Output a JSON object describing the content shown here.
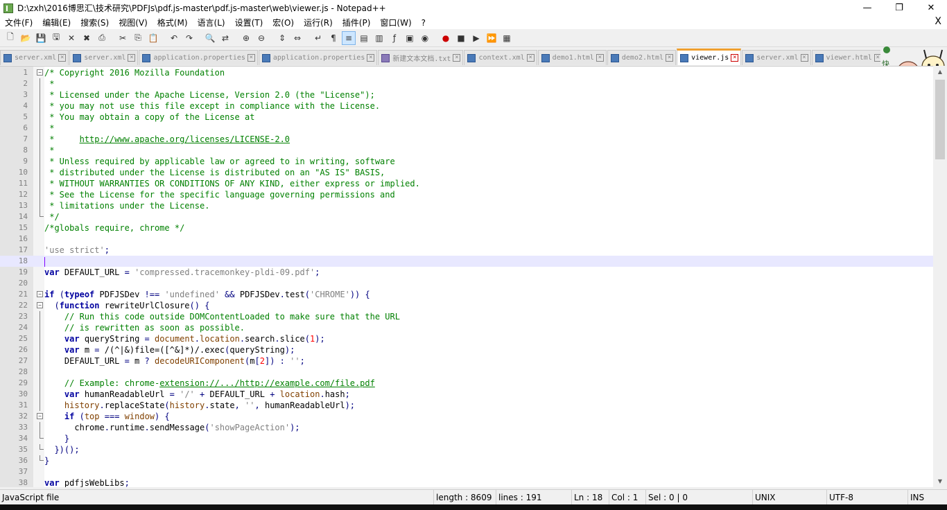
{
  "window": {
    "title": "D:\\zxh\\2016博思汇\\技术研究\\PDFJs\\pdf.js-master\\pdf.js-master\\web\\viewer.js - Notepad++",
    "minimize": "—",
    "maximize": "❐",
    "close": "✕"
  },
  "menu": {
    "items": [
      "文件(F)",
      "编辑(E)",
      "搜索(S)",
      "视图(V)",
      "格式(M)",
      "语言(L)",
      "设置(T)",
      "宏(O)",
      "运行(R)",
      "插件(P)",
      "窗口(W)",
      "?"
    ],
    "close": "X"
  },
  "tabs": [
    {
      "label": "server.xml",
      "active": false,
      "icon": "file-icon"
    },
    {
      "label": "server.xml",
      "active": false,
      "icon": "file-icon"
    },
    {
      "label": "application.properties",
      "active": false,
      "icon": "file-icon"
    },
    {
      "label": "application.properties",
      "active": false,
      "icon": "file-icon"
    },
    {
      "label": "新建文本文档.txt",
      "active": false,
      "icon": "text-file-icon"
    },
    {
      "label": "context.xml",
      "active": false,
      "icon": "file-icon"
    },
    {
      "label": "demo1.html",
      "active": false,
      "icon": "file-icon"
    },
    {
      "label": "demo2.html",
      "active": false,
      "icon": "file-icon"
    },
    {
      "label": "viewer.js",
      "active": true,
      "icon": "file-icon"
    },
    {
      "label": "server.xml",
      "active": false,
      "icon": "file-icon"
    },
    {
      "label": "viewer.html",
      "active": false,
      "icon": "file-icon"
    }
  ],
  "mascot_text": "快简。",
  "editor": {
    "current_line": 18,
    "lines": [
      {
        "n": "1",
        "fold": "minus",
        "parts": [
          [
            "c-com",
            "/* Copyright 2016 Mozilla Foundation"
          ]
        ]
      },
      {
        "n": "2",
        "fold": "bar",
        "parts": [
          [
            "c-com",
            " *"
          ]
        ]
      },
      {
        "n": "3",
        "fold": "bar",
        "parts": [
          [
            "c-com",
            " * Licensed under the Apache License, Version 2.0 (the \"License\");"
          ]
        ]
      },
      {
        "n": "4",
        "fold": "bar",
        "parts": [
          [
            "c-com",
            " * you may not use this file except in compliance with the License."
          ]
        ]
      },
      {
        "n": "5",
        "fold": "bar",
        "parts": [
          [
            "c-com",
            " * You may obtain a copy of the License at"
          ]
        ]
      },
      {
        "n": "6",
        "fold": "bar",
        "parts": [
          [
            "c-com",
            " *"
          ]
        ]
      },
      {
        "n": "7",
        "fold": "bar",
        "parts": [
          [
            "c-com",
            " *     "
          ],
          [
            "c-url",
            "http://www.apache.org/licenses/LICENSE-2.0"
          ]
        ]
      },
      {
        "n": "8",
        "fold": "bar",
        "parts": [
          [
            "c-com",
            " *"
          ]
        ]
      },
      {
        "n": "9",
        "fold": "bar",
        "parts": [
          [
            "c-com",
            " * Unless required by applicable law or agreed to in writing, software"
          ]
        ]
      },
      {
        "n": "10",
        "fold": "bar",
        "parts": [
          [
            "c-com",
            " * distributed under the License is distributed on an \"AS IS\" BASIS,"
          ]
        ]
      },
      {
        "n": "11",
        "fold": "bar",
        "parts": [
          [
            "c-com",
            " * WITHOUT WARRANTIES OR CONDITIONS OF ANY KIND, either express or implied."
          ]
        ]
      },
      {
        "n": "12",
        "fold": "bar",
        "parts": [
          [
            "c-com",
            " * See the License for the specific language governing permissions and"
          ]
        ]
      },
      {
        "n": "13",
        "fold": "bar",
        "parts": [
          [
            "c-com",
            " * limitations under the License."
          ]
        ]
      },
      {
        "n": "14",
        "fold": "end",
        "parts": [
          [
            "c-com",
            " */"
          ]
        ]
      },
      {
        "n": "15",
        "fold": "",
        "parts": [
          [
            "c-com",
            "/*globals require, chrome */"
          ]
        ]
      },
      {
        "n": "16",
        "fold": "",
        "parts": []
      },
      {
        "n": "17",
        "fold": "",
        "parts": [
          [
            "c-str",
            "'use strict'"
          ],
          [
            "c-op",
            ";"
          ]
        ]
      },
      {
        "n": "18",
        "fold": "",
        "parts": []
      },
      {
        "n": "19",
        "fold": "",
        "parts": [
          [
            "c-kw",
            "var"
          ],
          [
            "",
            " DEFAULT_URL "
          ],
          [
            "c-op",
            "="
          ],
          [
            "",
            " "
          ],
          [
            "c-str",
            "'compressed.tracemonkey-pldi-09.pdf'"
          ],
          [
            "c-op",
            ";"
          ]
        ]
      },
      {
        "n": "20",
        "fold": "",
        "parts": []
      },
      {
        "n": "21",
        "fold": "minus",
        "parts": [
          [
            "c-kw",
            "if"
          ],
          [
            "",
            " "
          ],
          [
            "c-op",
            "("
          ],
          [
            "c-kw",
            "typeof"
          ],
          [
            "",
            " PDFJSDev "
          ],
          [
            "c-op",
            "!=="
          ],
          [
            "",
            " "
          ],
          [
            "c-str",
            "'undefined'"
          ],
          [
            "",
            " "
          ],
          [
            "c-op",
            "&&"
          ],
          [
            "",
            " PDFJSDev"
          ],
          [
            "c-op",
            "."
          ],
          [
            "",
            "test"
          ],
          [
            "c-op",
            "("
          ],
          [
            "c-str",
            "'CHROME'"
          ],
          [
            "c-op",
            "))"
          ],
          [
            "",
            " "
          ],
          [
            "c-op",
            "{"
          ]
        ]
      },
      {
        "n": "22",
        "fold": "minus",
        "parts": [
          [
            "",
            "  "
          ],
          [
            "c-op",
            "("
          ],
          [
            "c-kw",
            "function"
          ],
          [
            "",
            " rewriteUrlClosure"
          ],
          [
            "c-op",
            "()"
          ],
          [
            "",
            " "
          ],
          [
            "c-op",
            "{"
          ]
        ]
      },
      {
        "n": "23",
        "fold": "bar",
        "parts": [
          [
            "",
            "    "
          ],
          [
            "c-com",
            "// Run this code outside DOMContentLoaded to make sure that the URL"
          ]
        ]
      },
      {
        "n": "24",
        "fold": "bar",
        "parts": [
          [
            "",
            "    "
          ],
          [
            "c-com",
            "// is rewritten as soon as possible."
          ]
        ]
      },
      {
        "n": "25",
        "fold": "bar",
        "parts": [
          [
            "",
            "    "
          ],
          [
            "c-kw",
            "var"
          ],
          [
            "",
            " queryString "
          ],
          [
            "c-op",
            "="
          ],
          [
            "",
            " "
          ],
          [
            "c-obj",
            "document"
          ],
          [
            "c-op",
            "."
          ],
          [
            "c-obj",
            "location"
          ],
          [
            "c-op",
            "."
          ],
          [
            "",
            "search"
          ],
          [
            "c-op",
            "."
          ],
          [
            "",
            "slice"
          ],
          [
            "c-op",
            "("
          ],
          [
            "c-num",
            "1"
          ],
          [
            "c-op",
            ");"
          ]
        ]
      },
      {
        "n": "26",
        "fold": "bar",
        "parts": [
          [
            "",
            "    "
          ],
          [
            "c-kw",
            "var"
          ],
          [
            "",
            " m "
          ],
          [
            "c-op",
            "="
          ],
          [
            "",
            " /(^|&)file=([^&]*)/.exec"
          ],
          [
            "c-op",
            "("
          ],
          [
            "",
            "queryString"
          ],
          [
            "c-op",
            ");"
          ]
        ]
      },
      {
        "n": "27",
        "fold": "bar",
        "parts": [
          [
            "",
            "    DEFAULT_URL "
          ],
          [
            "c-op",
            "="
          ],
          [
            "",
            " m "
          ],
          [
            "c-op",
            "?"
          ],
          [
            "",
            " "
          ],
          [
            "c-obj",
            "decodeURIComponent"
          ],
          [
            "c-op",
            "("
          ],
          [
            "",
            "m"
          ],
          [
            "c-op",
            "["
          ],
          [
            "c-num",
            "2"
          ],
          [
            "c-op",
            "])"
          ],
          [
            "",
            " "
          ],
          [
            "c-op",
            ":"
          ],
          [
            "",
            " "
          ],
          [
            "c-str",
            "''"
          ],
          [
            "c-op",
            ";"
          ]
        ]
      },
      {
        "n": "28",
        "fold": "bar",
        "parts": []
      },
      {
        "n": "29",
        "fold": "bar",
        "parts": [
          [
            "",
            "    "
          ],
          [
            "c-com",
            "// Example: chrome-"
          ],
          [
            "c-url",
            "extension://.../http://example.com/file.pdf"
          ]
        ]
      },
      {
        "n": "30",
        "fold": "bar",
        "parts": [
          [
            "",
            "    "
          ],
          [
            "c-kw",
            "var"
          ],
          [
            "",
            " humanReadableUrl "
          ],
          [
            "c-op",
            "="
          ],
          [
            "",
            " "
          ],
          [
            "c-str",
            "'/'"
          ],
          [
            "",
            " "
          ],
          [
            "c-op",
            "+"
          ],
          [
            "",
            " DEFAULT_URL "
          ],
          [
            "c-op",
            "+"
          ],
          [
            "",
            " "
          ],
          [
            "c-obj",
            "location"
          ],
          [
            "c-op",
            "."
          ],
          [
            "",
            "hash"
          ],
          [
            "c-op",
            ";"
          ]
        ]
      },
      {
        "n": "31",
        "fold": "bar",
        "parts": [
          [
            "",
            "    "
          ],
          [
            "c-obj",
            "history"
          ],
          [
            "c-op",
            "."
          ],
          [
            "",
            "replaceState"
          ],
          [
            "c-op",
            "("
          ],
          [
            "c-obj",
            "history"
          ],
          [
            "c-op",
            "."
          ],
          [
            "",
            "state"
          ],
          [
            "c-op",
            ","
          ],
          [
            "",
            " "
          ],
          [
            "c-str",
            "''"
          ],
          [
            "c-op",
            ","
          ],
          [
            "",
            " humanReadableUrl"
          ],
          [
            "c-op",
            ");"
          ]
        ]
      },
      {
        "n": "32",
        "fold": "minus",
        "parts": [
          [
            "",
            "    "
          ],
          [
            "c-kw",
            "if"
          ],
          [
            "",
            " "
          ],
          [
            "c-op",
            "("
          ],
          [
            "c-obj",
            "top"
          ],
          [
            "",
            " "
          ],
          [
            "c-op",
            "==="
          ],
          [
            "",
            " "
          ],
          [
            "c-obj",
            "window"
          ],
          [
            "c-op",
            ")"
          ],
          [
            "",
            " "
          ],
          [
            "c-op",
            "{"
          ]
        ]
      },
      {
        "n": "33",
        "fold": "bar",
        "parts": [
          [
            "",
            "      chrome"
          ],
          [
            "c-op",
            "."
          ],
          [
            "",
            "runtime"
          ],
          [
            "c-op",
            "."
          ],
          [
            "",
            "sendMessage"
          ],
          [
            "c-op",
            "("
          ],
          [
            "c-str",
            "'showPageAction'"
          ],
          [
            "c-op",
            ");"
          ]
        ]
      },
      {
        "n": "34",
        "fold": "end",
        "parts": [
          [
            "",
            "    "
          ],
          [
            "c-op",
            "}"
          ]
        ]
      },
      {
        "n": "35",
        "fold": "end",
        "parts": [
          [
            "",
            "  "
          ],
          [
            "c-op",
            "})();"
          ]
        ]
      },
      {
        "n": "36",
        "fold": "end",
        "parts": [
          [
            "c-op",
            "}"
          ]
        ]
      },
      {
        "n": "37",
        "fold": "",
        "parts": []
      },
      {
        "n": "38",
        "fold": "",
        "parts": [
          [
            "c-kw",
            "var"
          ],
          [
            "",
            " pdfjsWebLibs"
          ],
          [
            "c-op",
            ";"
          ]
        ]
      }
    ]
  },
  "status": {
    "filetype": "JavaScript file",
    "length": "length : 8609",
    "lines": "lines : 191",
    "ln": "Ln : 18",
    "col": "Col : 1",
    "sel": "Sel : 0 | 0",
    "eol": "UNIX",
    "encoding": "UTF-8",
    "mode": "INS"
  },
  "colors": {
    "comment": "#008000",
    "keyword": "#00009f",
    "string": "#808080",
    "number": "#ff0000",
    "active_tab_accent": "#f0a030",
    "current_line": "#e8e8ff"
  }
}
